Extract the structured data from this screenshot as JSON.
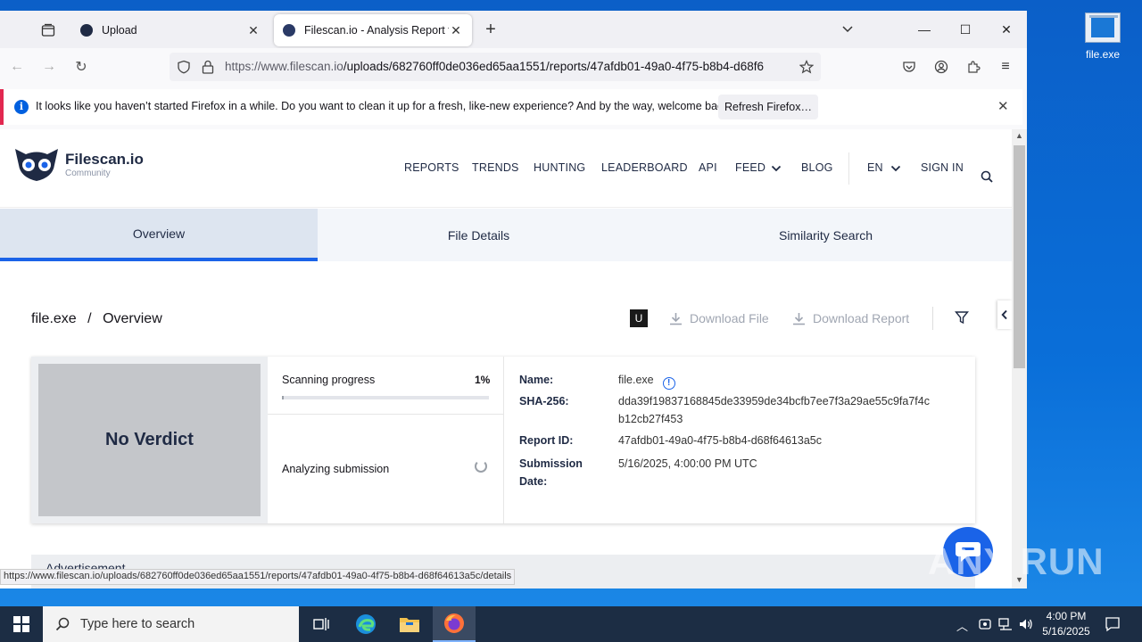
{
  "desktop": {
    "icon_label": "file.exe"
  },
  "browser": {
    "tabs": [
      {
        "title": "Upload"
      },
      {
        "title": "Filescan.io - Analysis Report for"
      }
    ],
    "url_host": "https://www.filescan.io",
    "url_path": "/uploads/682760ff0de036ed65aa1551/reports/47afdb01-49a0-4f75-b8b4-d68f6",
    "notification": {
      "message": "It looks like you haven’t started Firefox in a while. Do you want to clean it up for a fresh, like-new experience? And by the way, welcome back!",
      "button": "Refresh Firefox…"
    },
    "status_url": "https://www.filescan.io/uploads/682760ff0de036ed65aa1551/reports/47afdb01-49a0-4f75-b8b4-d68f64613a5c/details"
  },
  "site": {
    "logo_name": "Filescan.io",
    "logo_sub": "Community",
    "menu": [
      "REPORTS",
      "TRENDS",
      "HUNTING",
      "LEADERBOARD",
      "API",
      "FEED",
      "BLOG"
    ],
    "lang": "EN",
    "signin": "SIGN IN"
  },
  "page_tabs": [
    "Overview",
    "File Details",
    "Similarity Search"
  ],
  "breadcrumb": {
    "file": "file.exe",
    "sep": "/",
    "section": "Overview"
  },
  "toolbar": {
    "badge": "U",
    "download_file": "Download File",
    "download_report": "Download Report"
  },
  "verdict": "No Verdict",
  "scan": {
    "label": "Scanning progress",
    "percent": "1%",
    "progress": 0.01,
    "analyzing": "Analyzing submission"
  },
  "details": {
    "name_label": "Name:",
    "name": "file.exe",
    "sha_label": "SHA-256:",
    "sha": "dda39f19837168845de33959de34bcfb7ee7f3a29ae55c9fa7f4cb12cb27f453",
    "report_label": "Report ID:",
    "report": "47afdb01-49a0-4f75-b8b4-d68f64613a5c",
    "date_label": "Submission Date:",
    "date": "5/16/2025, 4:00:00 PM UTC"
  },
  "advertisement": "Advertisement",
  "watermark": "ANY RUN",
  "taskbar": {
    "search_placeholder": "Type here to search",
    "time": "4:00 PM",
    "date": "5/16/2025"
  }
}
